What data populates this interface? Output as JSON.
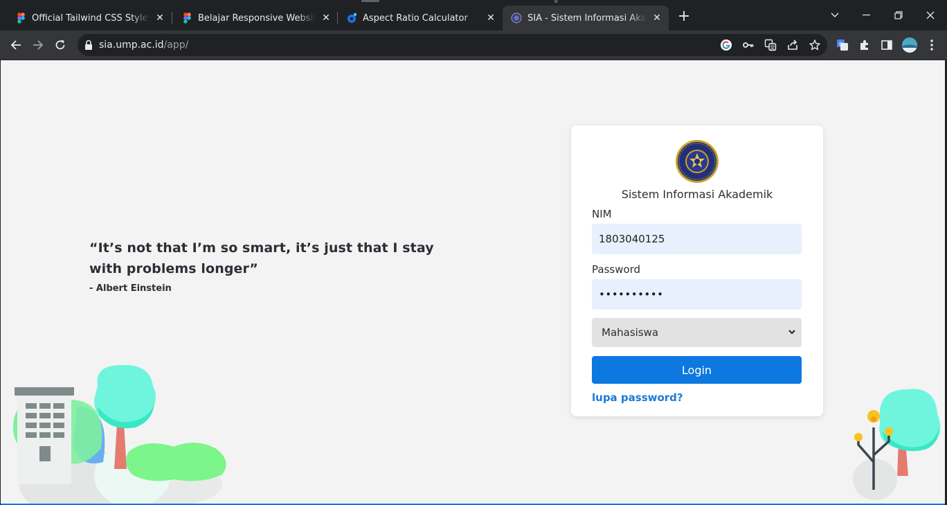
{
  "browser": {
    "tabs": [
      {
        "title": "Official Tailwind CSS Styles (Com",
        "favicon": "figma-icon"
      },
      {
        "title": "Belajar Responsive Website Next",
        "favicon": "figma-icon"
      },
      {
        "title": "Aspect Ratio Calculator",
        "favicon": "calculator-icon"
      },
      {
        "title": "SIA - Sistem Informasi Akademik",
        "favicon": "university-seal-icon",
        "active": true
      }
    ],
    "new_tab_label": "+",
    "url_host": "sia.ump.ac.id",
    "url_path": "/app/"
  },
  "page": {
    "quote": "“It’s not that I’m so smart, it’s just that I stay with problems longer”",
    "author": "- Albert Einstein",
    "login": {
      "title": "Sistem Informasi Akademik",
      "nim_label": "NIM",
      "nim_value": "1803040125",
      "password_label": "Password",
      "password_value": "••••••••••",
      "role_selected": "Mahasiswa",
      "login_button": "Login",
      "forgot_link": "lupa password?"
    }
  },
  "colors": {
    "page_background": "#f3f3f3",
    "primary_button": "#0c78e0",
    "link": "#1b7ad6",
    "input_fill": "#e8f0fe",
    "tree_mint": "#6ff5dd",
    "tree_green": "#7cf08a"
  }
}
